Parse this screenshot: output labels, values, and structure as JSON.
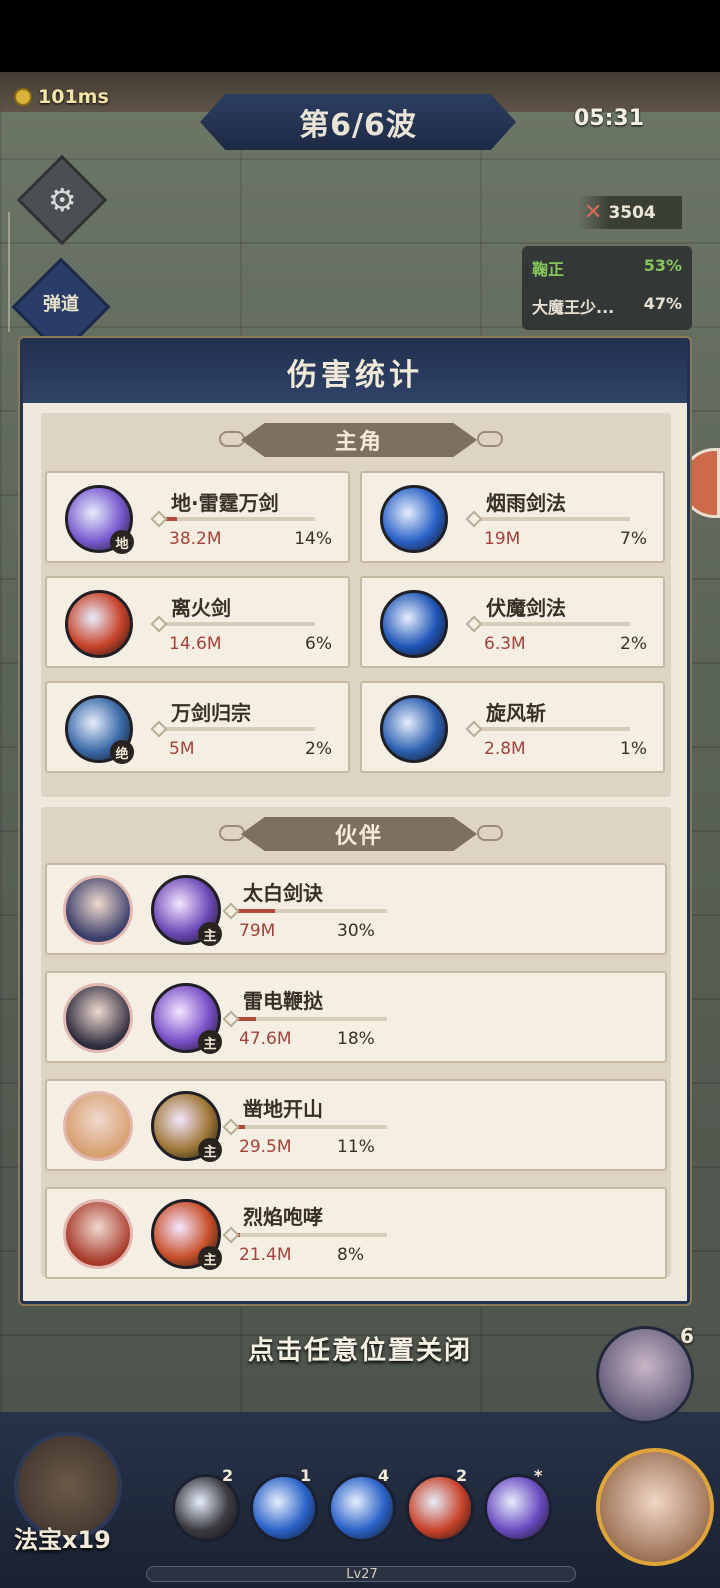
{
  "hud": {
    "ping": "101ms",
    "wave": "第6/6波",
    "timer": "05:31",
    "kills": "3504",
    "settings_icon": "gear-icon",
    "trajectory_label": "弹道",
    "damage_share": [
      {
        "name": "鞠正",
        "percent": "53%"
      },
      {
        "name": "大魔王少...",
        "percent": "47%"
      }
    ]
  },
  "modal": {
    "title": "伤害统计",
    "hero_section": {
      "title": "主角",
      "skills": [
        {
          "name": "地·雷霆万剑",
          "damage": "38.2M",
          "percent": "14%",
          "share": 0.14,
          "tag": "地",
          "color": "#7a5ad0"
        },
        {
          "name": "烟雨剑法",
          "damage": "19M",
          "percent": "7%",
          "share": 0.07,
          "tag": "",
          "color": "#2a62c8"
        },
        {
          "name": "离火剑",
          "damage": "14.6M",
          "percent": "6%",
          "share": 0.06,
          "tag": "",
          "color": "#c8432a"
        },
        {
          "name": "伏魔剑法",
          "damage": "6.3M",
          "percent": "2%",
          "share": 0.02,
          "tag": "",
          "color": "#1f56b8"
        },
        {
          "name": "万剑归宗",
          "damage": "5M",
          "percent": "2%",
          "share": 0.02,
          "tag": "绝",
          "color": "#3b6aa8"
        },
        {
          "name": "旋风斩",
          "damage": "2.8M",
          "percent": "1%",
          "share": 0.01,
          "tag": "",
          "color": "#2c5fb0"
        }
      ]
    },
    "partner_section": {
      "title": "伙伴",
      "partners": [
        {
          "skill": "太白剑诀",
          "damage": "79M",
          "percent": "30%",
          "share": 0.3,
          "tag": "主",
          "avatar_color": "#3a3e6a",
          "skill_color": "#6e4ab8"
        },
        {
          "skill": "雷电鞭挞",
          "damage": "47.6M",
          "percent": "18%",
          "share": 0.18,
          "tag": "主",
          "avatar_color": "#2e2c3e",
          "skill_color": "#7a50c8"
        },
        {
          "skill": "凿地开山",
          "damage": "29.5M",
          "percent": "11%",
          "share": 0.11,
          "tag": "主",
          "avatar_color": "#d8a070",
          "skill_color": "#a07838"
        },
        {
          "skill": "烈焰咆哮",
          "damage": "21.4M",
          "percent": "8%",
          "share": 0.08,
          "tag": "主",
          "avatar_color": "#a83a2a",
          "skill_color": "#c8502a"
        }
      ]
    },
    "close_hint": "点击任意位置关闭"
  },
  "bottom": {
    "treasure_label": "法宝x19",
    "hero_count": "6",
    "level": "Lv27",
    "dock_skills": [
      {
        "count": "2",
        "color": "#3a3a40"
      },
      {
        "count": "1",
        "color": "#2a62c8"
      },
      {
        "count": "4",
        "color": "#2a62c8"
      },
      {
        "count": "2",
        "color": "#c8432a"
      },
      {
        "count": "*",
        "color": "#6a4ac0"
      }
    ]
  }
}
